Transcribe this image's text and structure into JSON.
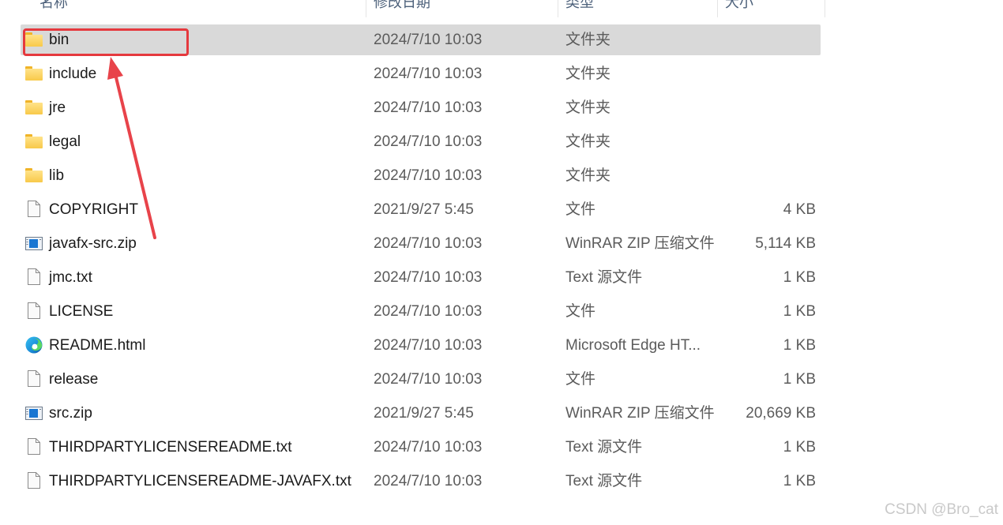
{
  "columns": {
    "name": "名称",
    "date": "修改日期",
    "type": "类型",
    "size": "大小"
  },
  "files": [
    {
      "name": "bin",
      "date": "2024/7/10 10:03",
      "type": "文件夹",
      "size": "",
      "icon": "folder-icon",
      "selected": true
    },
    {
      "name": "include",
      "date": "2024/7/10 10:03",
      "type": "文件夹",
      "size": "",
      "icon": "folder-icon"
    },
    {
      "name": "jre",
      "date": "2024/7/10 10:03",
      "type": "文件夹",
      "size": "",
      "icon": "folder-icon"
    },
    {
      "name": "legal",
      "date": "2024/7/10 10:03",
      "type": "文件夹",
      "size": "",
      "icon": "folder-icon"
    },
    {
      "name": "lib",
      "date": "2024/7/10 10:03",
      "type": "文件夹",
      "size": "",
      "icon": "folder-icon"
    },
    {
      "name": "COPYRIGHT",
      "date": "2021/9/27 5:45",
      "type": "文件",
      "size": "4 KB",
      "icon": "file-icon"
    },
    {
      "name": "javafx-src.zip",
      "date": "2024/7/10 10:03",
      "type": "WinRAR ZIP 压缩文件",
      "size": "5,114 KB",
      "icon": "zip-icon"
    },
    {
      "name": "jmc.txt",
      "date": "2024/7/10 10:03",
      "type": "Text 源文件",
      "size": "1 KB",
      "icon": "file-icon"
    },
    {
      "name": "LICENSE",
      "date": "2024/7/10 10:03",
      "type": "文件",
      "size": "1 KB",
      "icon": "file-icon"
    },
    {
      "name": "README.html",
      "date": "2024/7/10 10:03",
      "type": "Microsoft Edge HT...",
      "size": "1 KB",
      "icon": "edge-icon"
    },
    {
      "name": "release",
      "date": "2024/7/10 10:03",
      "type": "文件",
      "size": "1 KB",
      "icon": "file-icon"
    },
    {
      "name": "src.zip",
      "date": "2021/9/27 5:45",
      "type": "WinRAR ZIP 压缩文件",
      "size": "20,669 KB",
      "icon": "zip-icon"
    },
    {
      "name": "THIRDPARTYLICENSEREADME.txt",
      "date": "2024/7/10 10:03",
      "type": "Text 源文件",
      "size": "1 KB",
      "icon": "file-icon"
    },
    {
      "name": "THIRDPARTYLICENSEREADME-JAVAFX.txt",
      "date": "2024/7/10 10:03",
      "type": "Text 源文件",
      "size": "1 KB",
      "icon": "file-icon"
    }
  ],
  "annotation": {
    "target": "bin",
    "color": "#e5393e"
  },
  "watermark": "CSDN @Bro_cat"
}
